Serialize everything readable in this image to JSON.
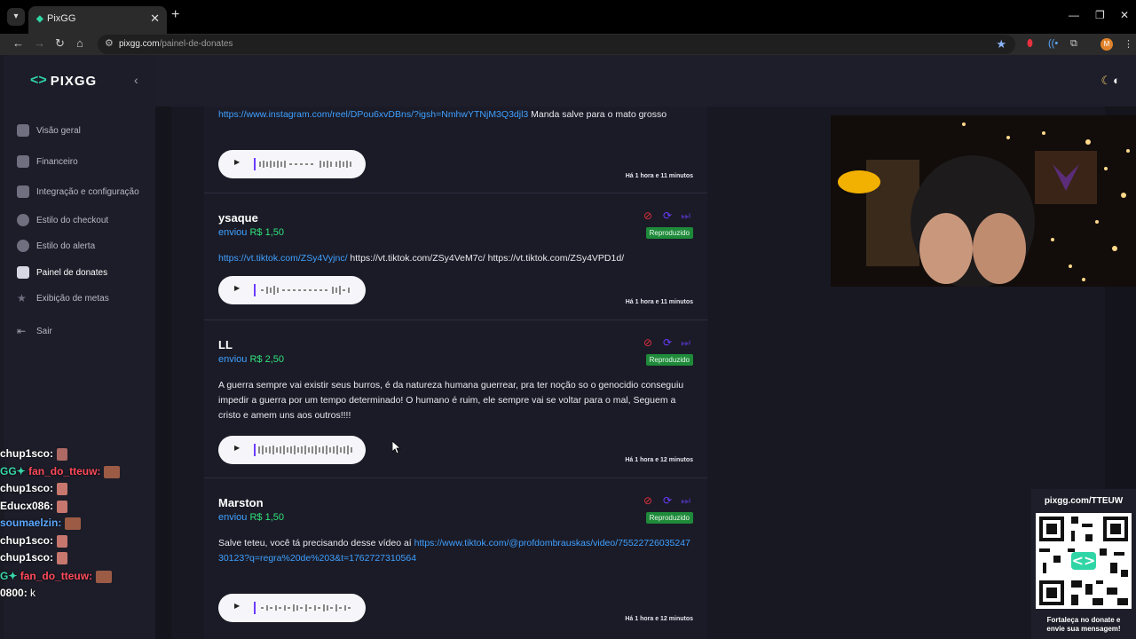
{
  "browser": {
    "tab_title": "PixGG",
    "url_host": "pixgg.com",
    "url_path": "/painel-de-donates",
    "profile_initial": "M"
  },
  "sidebar": {
    "logo": "PIXGG",
    "items": [
      {
        "label": "Visão geral",
        "icon": "home-icon"
      },
      {
        "label": "Financeiro",
        "icon": "wallet-icon"
      },
      {
        "label": "Integração e configuração",
        "icon": "settings-icon"
      },
      {
        "label": "Estilo do checkout",
        "icon": "palette-icon"
      },
      {
        "label": "Estilo do alerta",
        "icon": "palette-icon"
      },
      {
        "label": "Painel de donates",
        "icon": "donate-icon",
        "active": true
      },
      {
        "label": "Exibição de metas",
        "icon": "star-icon"
      },
      {
        "label": "Sair",
        "icon": "logout-icon"
      }
    ]
  },
  "donations": [
    {
      "name": "",
      "sent_label": "",
      "amount": "",
      "message": [
        {
          "text": "https://www.instagram.com/reel/DPou6xvDBns/?igsh=NmhwYTNjM3Q3djl3",
          "link": true
        },
        {
          "text": " Manda salve para o mato grosso",
          "link": false
        }
      ],
      "status": "",
      "time": "Há 1 hora e 11 minutos"
    },
    {
      "name": "ysaque",
      "sent_label": "enviou",
      "amount": "R$ 1,50",
      "message": [
        {
          "text": "https://vt.tiktok.com/ZSy4Vyjnc/",
          "link": true
        },
        {
          "text": " https://vt.tiktok.com/ZSy4VeM7c/ https://vt.tiktok.com/ZSy4VPD1d/",
          "link": false
        }
      ],
      "status": "Reproduzido",
      "time": "Há 1 hora e 11 minutos"
    },
    {
      "name": "LL",
      "sent_label": "enviou",
      "amount": "R$ 2,50",
      "message": [
        {
          "text": "A guerra sempre vai existir seus burros, é da natureza humana guerrear, pra ter noção so o genocidio conseguiu impedir a guerra por um tempo determinado! O humano é ruim, ele sempre vai se voltar para o mal, Seguem a cristo e amem uns aos outros!!!!",
          "link": false
        }
      ],
      "status": "Reproduzido",
      "time": "Há 1 hora e 12 minutos"
    },
    {
      "name": "Marston",
      "sent_label": "enviou",
      "amount": "R$ 1,50",
      "message": [
        {
          "text": "Salve teteu, você tá precisando desse vídeo aí ",
          "link": false
        },
        {
          "text": "https://www.tiktok.com/@profdombrauskas/video/7552272603524730123?q=regra%20de%203&t=1762727310564",
          "link": true
        }
      ],
      "status": "Reproduzido",
      "time": "Há 1 hora e 12 minutos"
    }
  ],
  "stream_chat": [
    {
      "user": "chup1sco:",
      "color": "#ffffff",
      "msg": "",
      "emote": "hand"
    },
    {
      "user": "fan_do_tteuw:",
      "color": "#ff4a5a",
      "msg": "",
      "emote": "cat",
      "prefix": "GG✦"
    },
    {
      "user": "chup1sco:",
      "color": "#ffffff",
      "msg": "",
      "emote": "hand"
    },
    {
      "user": "Educx086:",
      "color": "#ffffff",
      "msg": "",
      "emote": "hand"
    },
    {
      "user": "soumaelzin:",
      "color": "#5aa7ff",
      "msg": "",
      "emote": "cat"
    },
    {
      "user": "chup1sco:",
      "color": "#ffffff",
      "msg": "",
      "emote": "hand"
    },
    {
      "user": "chup1sco:",
      "color": "#ffffff",
      "msg": "",
      "emote": "hand"
    },
    {
      "user": "fan_do_tteuw:",
      "color": "#ff4a5a",
      "msg": "",
      "emote": "cat",
      "prefix": "G✦"
    },
    {
      "user": "0800:",
      "color": "#ffffff",
      "msg": "k",
      "emote": ""
    }
  ],
  "qr_panel": {
    "url_label": "pixgg.com/TTEUW",
    "cta_line1": "Fortaleça no donate e",
    "cta_line2": "envie sua mensagem!"
  },
  "colors": {
    "accent": "#30d5a6",
    "link": "#3fa0ff",
    "amount": "#2fe27a",
    "badge": "#1e8a3a",
    "block": "#e0303a",
    "replay": "#6c3cff"
  }
}
